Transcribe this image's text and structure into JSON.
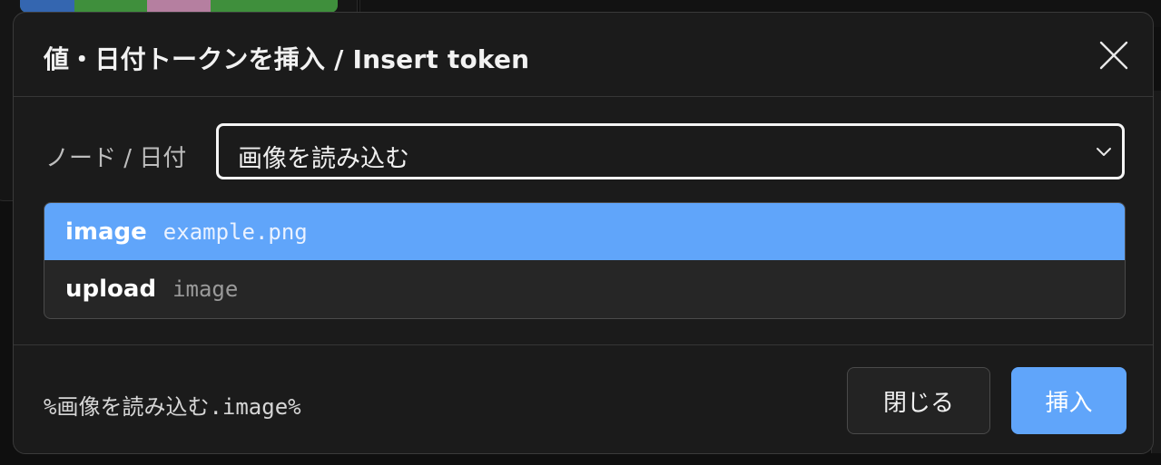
{
  "dialog": {
    "title": "値・日付トークンを挿入 / Insert token"
  },
  "field": {
    "label": "ノード / 日付",
    "selected": "画像を読み込む"
  },
  "options": [
    {
      "key": "image",
      "value": "example.png",
      "selected": true
    },
    {
      "key": "upload",
      "value": "image",
      "selected": false
    }
  ],
  "footer": {
    "preview": "%画像を読み込む.image%",
    "close_label": "閉じる",
    "insert_label": "挿入"
  },
  "icons": {
    "close": "close-icon",
    "dropdown": "chevron-down-icon"
  },
  "colors": {
    "accent": "#60a5fa",
    "background": "#1b1b1b"
  }
}
